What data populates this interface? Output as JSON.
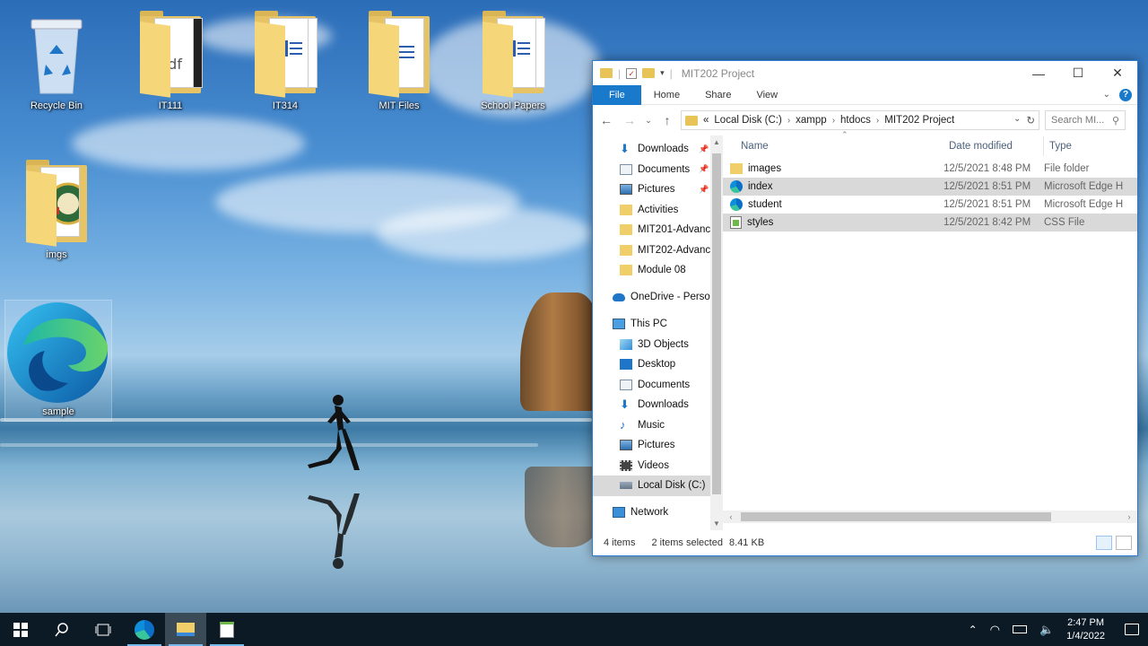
{
  "desktop": {
    "icons": [
      {
        "label": "Recycle Bin"
      },
      {
        "label": "IT111"
      },
      {
        "label": "IT314"
      },
      {
        "label": "MIT Files"
      },
      {
        "label": "School Papers"
      },
      {
        "label": "imgs"
      },
      {
        "label": "sample"
      }
    ]
  },
  "explorer": {
    "title": "MIT202 Project",
    "ribbon": {
      "file": "File",
      "home": "Home",
      "share": "Share",
      "view": "View"
    },
    "address": {
      "overflow": "«",
      "crumbs": [
        "Local Disk (C:)",
        "xampp",
        "htdocs",
        "MIT202 Project"
      ]
    },
    "search_placeholder": "Search MI...",
    "nav": {
      "quick": [
        {
          "label": "Downloads",
          "pinned": true
        },
        {
          "label": "Documents",
          "pinned": true
        },
        {
          "label": "Pictures",
          "pinned": true
        },
        {
          "label": "Activities"
        },
        {
          "label": "MIT201-Advanc"
        },
        {
          "label": "MIT202-Advanc"
        },
        {
          "label": "Module 08"
        }
      ],
      "onedrive": "OneDrive - Person",
      "thispc": "This PC",
      "pc_items": [
        "3D Objects",
        "Desktop",
        "Documents",
        "Downloads",
        "Music",
        "Pictures",
        "Videos",
        "Local Disk (C:)"
      ],
      "network": "Network"
    },
    "columns": {
      "name": "Name",
      "date": "Date modified",
      "type": "Type"
    },
    "files": [
      {
        "name": "images",
        "date": "12/5/2021 8:48 PM",
        "type": "File folder",
        "icon": "folder-icon"
      },
      {
        "name": "index",
        "date": "12/5/2021 8:51 PM",
        "type": "Microsoft Edge H",
        "icon": "edge-icon"
      },
      {
        "name": "student",
        "date": "12/5/2021 8:51 PM",
        "type": "Microsoft Edge H",
        "icon": "edge-icon"
      },
      {
        "name": "styles",
        "date": "12/5/2021 8:42 PM",
        "type": "CSS File",
        "icon": "css-file-icon"
      }
    ],
    "status": {
      "count": "4 items",
      "selected": "2 items selected",
      "size": "8.41 KB"
    }
  },
  "taskbar": {
    "time": "2:47 PM",
    "date": "1/4/2022"
  }
}
